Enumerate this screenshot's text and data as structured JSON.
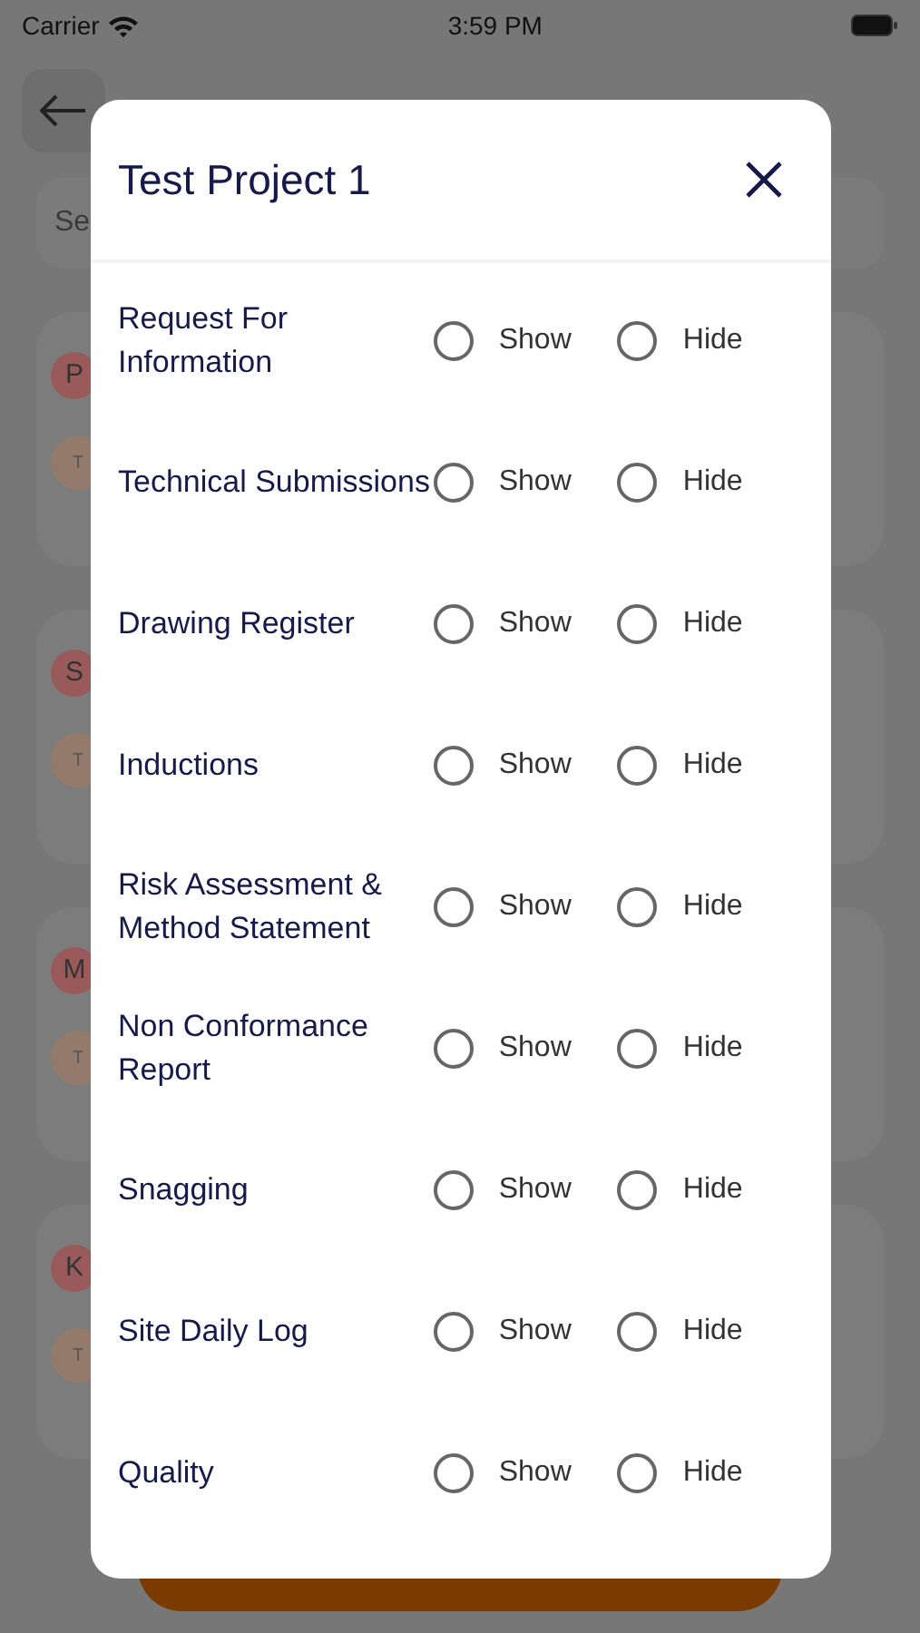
{
  "status_bar": {
    "carrier": "Carrier",
    "time": "3:59 PM"
  },
  "background": {
    "search": {
      "placeholder": "Se"
    },
    "cards": [
      {
        "avatar": "P",
        "sub_avatar": "T"
      },
      {
        "avatar": "S",
        "sub_avatar": "T"
      },
      {
        "avatar": "M",
        "sub_avatar": "T"
      },
      {
        "avatar": "K",
        "sub_avatar": "T"
      }
    ]
  },
  "modal": {
    "title": "Test Project 1",
    "rows": [
      {
        "label": "Request For Information",
        "options": [
          {
            "label": "Show",
            "selected": false
          },
          {
            "label": "Hide",
            "selected": false
          }
        ]
      },
      {
        "label": "Technical Submissions",
        "options": [
          {
            "label": "Show",
            "selected": false
          },
          {
            "label": "Hide",
            "selected": false
          }
        ]
      },
      {
        "label": "Drawing Register",
        "options": [
          {
            "label": "Show",
            "selected": false
          },
          {
            "label": "Hide",
            "selected": false
          }
        ]
      },
      {
        "label": "Inductions",
        "options": [
          {
            "label": "Show",
            "selected": false
          },
          {
            "label": "Hide",
            "selected": false
          }
        ]
      },
      {
        "label": "Risk Assessment & Method Statement",
        "options": [
          {
            "label": "Show",
            "selected": false
          },
          {
            "label": "Hide",
            "selected": false
          }
        ]
      },
      {
        "label": "Non Conformance Report",
        "options": [
          {
            "label": "Show",
            "selected": false
          },
          {
            "label": "Hide",
            "selected": false
          }
        ]
      },
      {
        "label": "Snagging",
        "options": [
          {
            "label": "Show",
            "selected": false
          },
          {
            "label": "Hide",
            "selected": false
          }
        ]
      },
      {
        "label": "Site Daily Log",
        "options": [
          {
            "label": "Show",
            "selected": false
          },
          {
            "label": "Hide",
            "selected": false
          }
        ]
      },
      {
        "label": "Quality",
        "options": [
          {
            "label": "Show",
            "selected": false
          },
          {
            "label": "Hide",
            "selected": false
          }
        ]
      }
    ]
  }
}
